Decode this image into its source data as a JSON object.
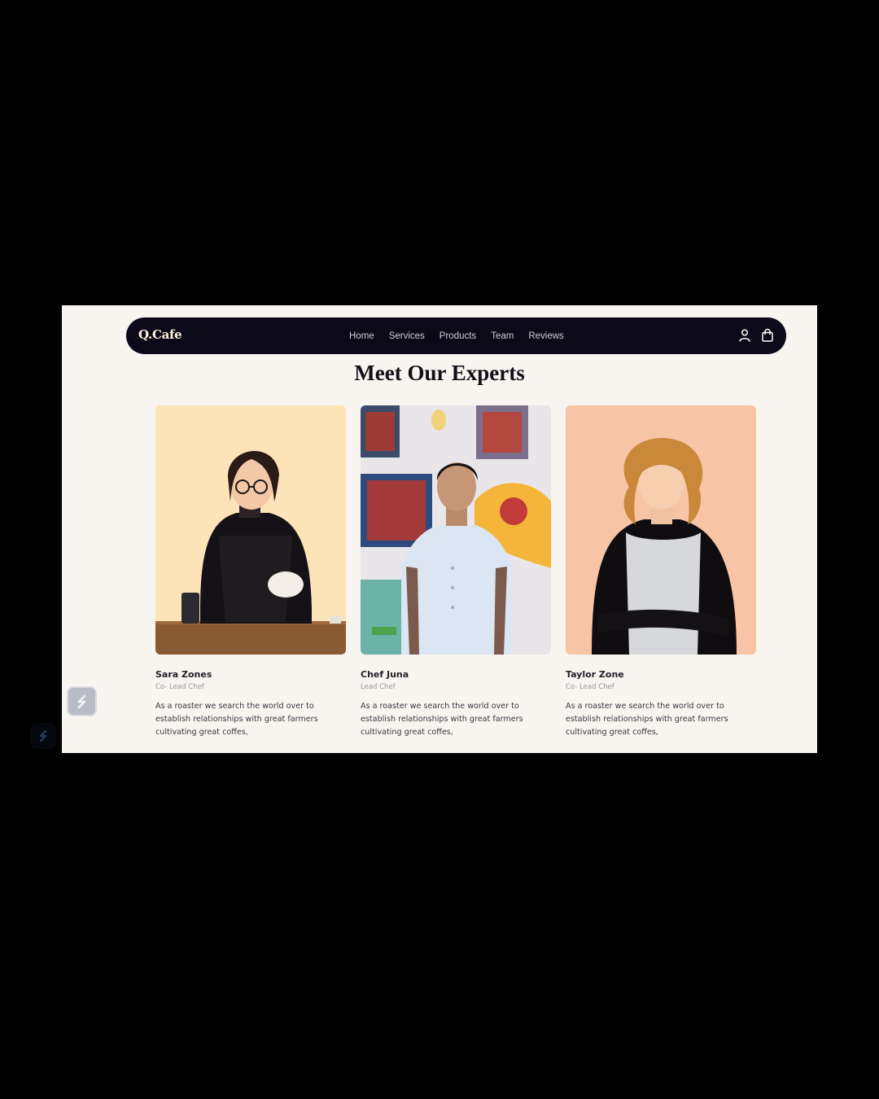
{
  "brand": {
    "logo_text": "Q.Cafe"
  },
  "nav": {
    "links": [
      "Home",
      "Services",
      "Products",
      "Team",
      "Reviews"
    ],
    "icons": [
      "user-icon",
      "shopping-bag-icon"
    ]
  },
  "section": {
    "title": "Meet Our Experts"
  },
  "experts": [
    {
      "name": "Sara Zones",
      "role": "Co- Lead Chef",
      "description": "As a roaster we search the world over to establish relationships with great farmers cultivating great coffes,",
      "photo_bg": "#fde3b8"
    },
    {
      "name": "Chef Juna",
      "role": "Lead Chef",
      "description": "As a roaster we search the world over to establish relationships with great farmers cultivating great coffes,",
      "photo_bg": "#e9e6ea"
    },
    {
      "name": "Taylor Zone",
      "role": "Co- Lead Chef",
      "description": "As a roaster we search the world over to establish relationships with great farmers cultivating great coffes,",
      "photo_bg": "#f7c4a6"
    }
  ],
  "colors": {
    "navbar_bg": "#0c0a18",
    "page_bg": "#f8f5f0",
    "outer_bg": "#000000",
    "title_color": "#111018"
  }
}
